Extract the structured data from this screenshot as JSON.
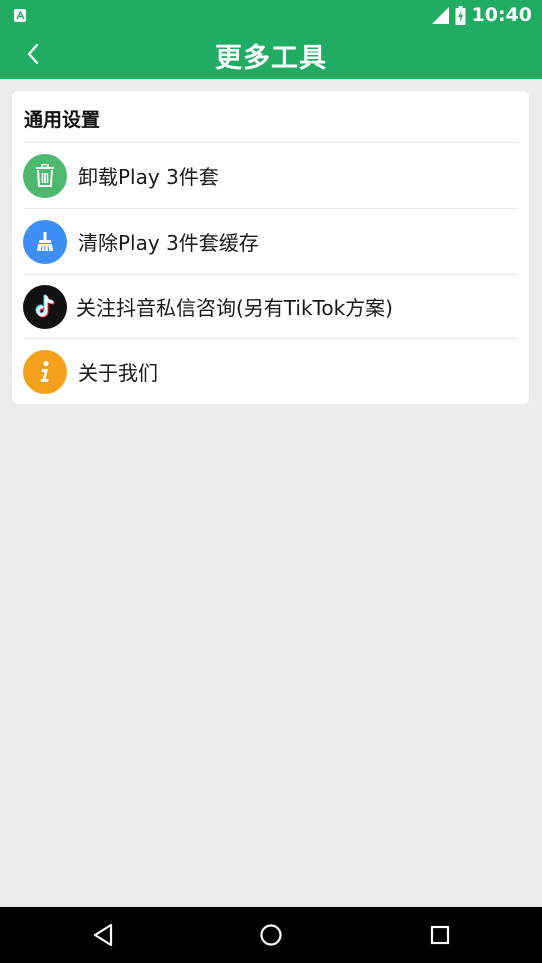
{
  "status_bar": {
    "time": "10:40",
    "notification_icon": "app-notification-icon",
    "signal_icon": "signal-icon",
    "battery_icon": "battery-charging-icon"
  },
  "app_bar": {
    "title": "更多工具",
    "back_icon": "chevron-left-icon",
    "color": "#21ac64"
  },
  "card": {
    "section_title": "通用设置",
    "items": [
      {
        "label": "卸载Play 3件套",
        "icon": "trash-icon",
        "icon_bg": "#4cb96f"
      },
      {
        "label": "清除Play 3件套缓存",
        "icon": "broom-icon",
        "icon_bg": "#3d8ef7"
      },
      {
        "label": "关注抖音私信咨询(另有TikTok方案)",
        "icon": "tiktok-icon",
        "icon_bg": "#111111"
      },
      {
        "label": "关于我们",
        "icon": "info-icon",
        "icon_bg": "#f5a01a"
      }
    ]
  },
  "nav_bar": {
    "back": "nav-back-icon",
    "home": "nav-home-icon",
    "recents": "nav-recents-icon"
  }
}
